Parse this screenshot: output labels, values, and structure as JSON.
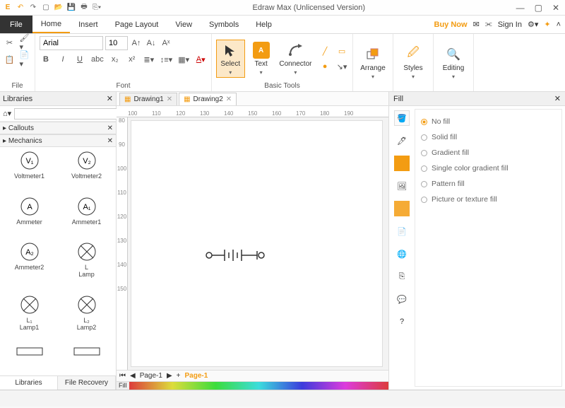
{
  "title": "Edraw Max (Unlicensed Version)",
  "menu": {
    "file": "File",
    "items": [
      "Home",
      "Insert",
      "Page Layout",
      "View",
      "Symbols",
      "Help"
    ],
    "active": 0,
    "buynow": "Buy Now",
    "signin": "Sign In"
  },
  "ribbon": {
    "file_label": "File",
    "font_label": "Font",
    "font_name": "Arial",
    "font_size": "10",
    "basic_label": "Basic Tools",
    "select": "Select",
    "text": "Text",
    "connector": "Connector",
    "arrange": "Arrange",
    "styles": "Styles",
    "editing": "Editing"
  },
  "libraries": {
    "title": "Libraries",
    "section_callouts": "Callouts",
    "section_mechanics": "Mechanics",
    "shapes": [
      {
        "label": "Voltmeter1",
        "g": "V₁"
      },
      {
        "label": "Voltmeter2",
        "g": "V₂"
      },
      {
        "label": "Ammeter",
        "g": "A"
      },
      {
        "label": "Ammeter1",
        "g": "A₁"
      },
      {
        "label": "Ammeter2",
        "g": "A₂"
      },
      {
        "label": "Lamp",
        "g": "⊗",
        "sub": "L"
      },
      {
        "label": "Lamp1",
        "g": "⊗",
        "sub": "L₁"
      },
      {
        "label": "Lamp2",
        "g": "⊗",
        "sub": "L₂"
      },
      {
        "label": "",
        "g": "▭"
      },
      {
        "label": "",
        "g": "▭"
      }
    ],
    "tab_lib": "Libraries",
    "tab_recovery": "File Recovery"
  },
  "docs": {
    "tabs": [
      "Drawing1",
      "Drawing2"
    ],
    "active": 1
  },
  "ruler_h": [
    "100",
    "110",
    "120",
    "130",
    "140",
    "150",
    "160",
    "170",
    "180",
    "190"
  ],
  "ruler_v": [
    "80",
    "90",
    "100",
    "110",
    "120",
    "130",
    "140",
    "150"
  ],
  "pagebar": {
    "page_a": "Page-1",
    "plus": "+",
    "page_b": "Page-1"
  },
  "colorstrip_label": "Fill",
  "fill": {
    "title": "Fill",
    "options": [
      "No fill",
      "Solid fill",
      "Gradient fill",
      "Single color gradient fill",
      "Pattern fill",
      "Picture or texture fill"
    ],
    "selected": 0
  }
}
